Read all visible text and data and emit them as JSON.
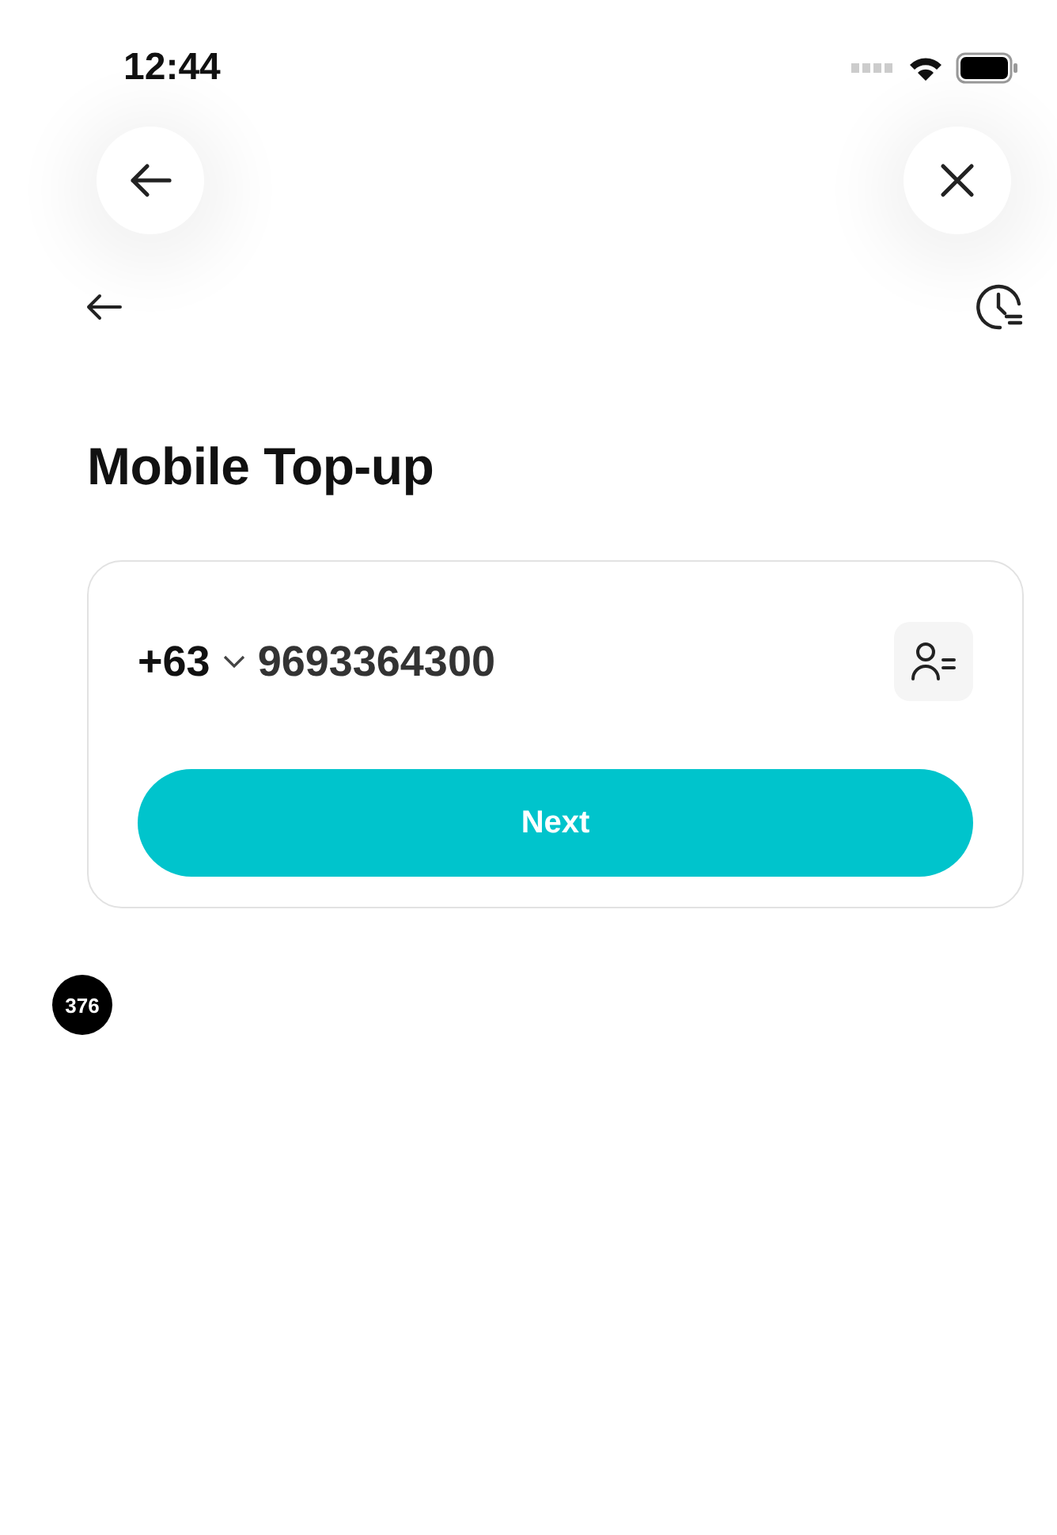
{
  "status_bar": {
    "time": "12:44"
  },
  "title": "Mobile Top-up",
  "phone": {
    "country_code": "+63",
    "number": "9693364300"
  },
  "next_button": {
    "label": "Next"
  },
  "badge": "376"
}
